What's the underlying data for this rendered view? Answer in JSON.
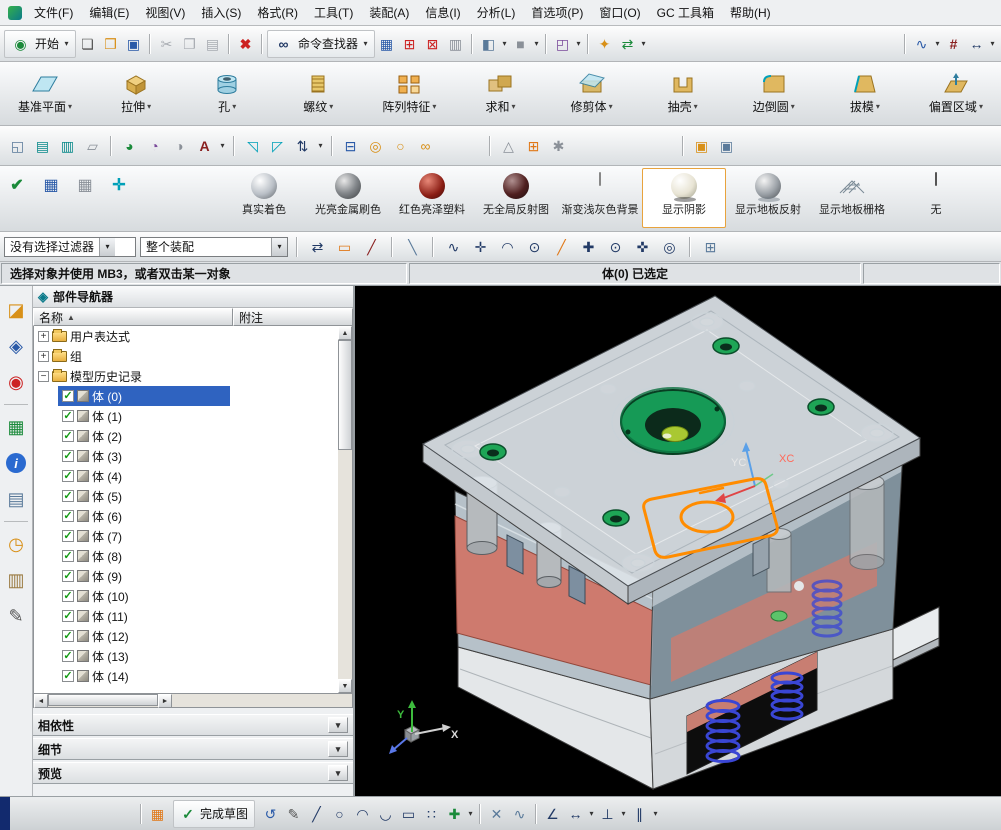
{
  "glyphs": {
    "dd": "▾",
    "plus": "+",
    "minus": "−",
    "check": "✓",
    "sort_asc": "▲",
    "left": "◄",
    "right": "►",
    "up": "▲",
    "down": "▼",
    "chev": "▾"
  },
  "menubar": {
    "items": [
      "文件(F)",
      "编辑(E)",
      "视图(V)",
      "插入(S)",
      "格式(R)",
      "工具(T)",
      "装配(A)",
      "信息(I)",
      "分析(L)",
      "首选项(P)",
      "窗口(O)",
      "GC 工具箱",
      "帮助(H)"
    ]
  },
  "toolbar_main": {
    "start_label": "开始",
    "command_finder_label": "命令查找器"
  },
  "features": {
    "items": [
      "基准平面",
      "拉伸",
      "孔",
      "螺纹",
      "阵列特征",
      "求和",
      "修剪体",
      "抽壳",
      "边倒圆",
      "拔模",
      "偏置区域"
    ]
  },
  "render_bar": {
    "items": [
      {
        "label": "真实着色",
        "selected": false
      },
      {
        "label": "光亮金属刷色",
        "selected": false
      },
      {
        "label": "红色亮泽塑料",
        "selected": false
      },
      {
        "label": "无全局反射图",
        "selected": false
      },
      {
        "label": "渐变浅灰色背景",
        "selected": false
      },
      {
        "label": "显示阴影",
        "selected": true
      },
      {
        "label": "显示地板反射",
        "selected": false
      },
      {
        "label": "显示地板栅格",
        "selected": false
      },
      {
        "label": "无",
        "selected": false
      }
    ]
  },
  "selection_bar": {
    "filter_value": "没有选择过滤器",
    "scope_value": "整个装配"
  },
  "status_bar": {
    "prompt": "选择对象并使用 MB3，或者双击某一对象",
    "status": "体(0) 已选定"
  },
  "navigator": {
    "title": "部件导航器",
    "columns": {
      "name": "名称",
      "note": "附注"
    },
    "folders": [
      {
        "label": "用户表达式",
        "state": "collapsed"
      },
      {
        "label": "组",
        "state": "collapsed"
      },
      {
        "label": "模型历史记录",
        "state": "expanded"
      }
    ],
    "bodies": [
      {
        "label": "体 (0)",
        "checked": true,
        "selected": true
      },
      {
        "label": "体 (1)",
        "checked": true
      },
      {
        "label": "体 (2)",
        "checked": true
      },
      {
        "label": "体 (3)",
        "checked": true
      },
      {
        "label": "体 (4)",
        "checked": true
      },
      {
        "label": "体 (5)",
        "checked": true
      },
      {
        "label": "体 (6)",
        "checked": true
      },
      {
        "label": "体 (7)",
        "checked": true
      },
      {
        "label": "体 (8)",
        "checked": true
      },
      {
        "label": "体 (9)",
        "checked": true
      },
      {
        "label": "体 (10)",
        "checked": true
      },
      {
        "label": "体 (11)",
        "checked": true
      },
      {
        "label": "体 (12)",
        "checked": true
      },
      {
        "label": "体 (13)",
        "checked": true
      },
      {
        "label": "体 (14)",
        "checked": true
      }
    ],
    "panels": [
      {
        "label": "相依性"
      },
      {
        "label": "细节"
      },
      {
        "label": "预览"
      }
    ]
  },
  "viewport": {
    "axis_labels": {
      "yc": "YC",
      "xc": "XC",
      "x": "X",
      "y": "Y"
    }
  },
  "bottom_bar": {
    "finish_label": "完成草图"
  },
  "icons": {
    "row2": [
      {
        "n": "start",
        "g": "◉"
      },
      {
        "n": "new-file",
        "g": "❏"
      },
      {
        "n": "open",
        "g": "❒"
      },
      {
        "n": "save",
        "g": "▣"
      },
      {
        "n": "cut",
        "g": "✂"
      },
      {
        "n": "copy",
        "g": "❐"
      },
      {
        "n": "paste",
        "g": "▤"
      },
      {
        "n": "delete",
        "g": "✖"
      },
      {
        "n": "command-finder",
        "g": "∞"
      },
      {
        "n": "window",
        "g": "▦"
      },
      {
        "n": "capture",
        "g": "⊞"
      },
      {
        "n": "capture-region",
        "g": "⊠"
      },
      {
        "n": "print",
        "g": "▥"
      },
      {
        "n": "view-cube",
        "g": "◧"
      },
      {
        "n": "display-mode",
        "g": "■"
      },
      {
        "n": "cascade",
        "g": "◰"
      },
      {
        "n": "spark",
        "g": "✦"
      },
      {
        "n": "export",
        "g": "⇄"
      },
      {
        "n": "curve",
        "g": "∿"
      },
      {
        "n": "pattern",
        "g": "#"
      },
      {
        "n": "measure",
        "g": "↔"
      }
    ],
    "row4": [
      {
        "n": "view-window",
        "g": "◱"
      },
      {
        "n": "layer-settings",
        "g": "▤"
      },
      {
        "n": "layer-category",
        "g": "▥"
      },
      {
        "n": "sheet",
        "g": "▱"
      },
      {
        "n": "shaded-view",
        "g": "◕"
      },
      {
        "n": "wireframe-view",
        "g": "◔"
      },
      {
        "n": "render-style",
        "g": "◑"
      },
      {
        "n": "annotation",
        "g": "A"
      },
      {
        "n": "datum-plane-sm",
        "g": "◹"
      },
      {
        "n": "datum-axis-sm",
        "g": "◸"
      },
      {
        "n": "sort",
        "g": "⇅"
      },
      {
        "n": "expressions-db",
        "g": "⊟"
      },
      {
        "n": "coins",
        "g": "◎"
      },
      {
        "n": "ring",
        "g": "○"
      },
      {
        "n": "link",
        "g": "∞"
      },
      {
        "n": "triangle-mesh",
        "g": "△"
      },
      {
        "n": "grid-plus",
        "g": "⊞"
      },
      {
        "n": "gears",
        "g": "✱"
      },
      {
        "n": "assembly-pair",
        "g": "▣"
      },
      {
        "n": "assembly-pair-2",
        "g": "▣"
      }
    ],
    "row5": [
      {
        "n": "sketch-check",
        "g": "✔"
      },
      {
        "n": "spreadsheet",
        "g": "▦"
      },
      {
        "n": "grid",
        "g": "▦"
      },
      {
        "n": "csys",
        "g": "✛"
      }
    ],
    "snap": [
      {
        "n": "two-point",
        "g": "⇄"
      },
      {
        "n": "rect-snap",
        "g": "▭"
      },
      {
        "n": "end-point",
        "g": "╱"
      },
      {
        "n": "mid-point",
        "g": "╲"
      },
      {
        "n": "curve-snap",
        "g": "∿"
      },
      {
        "n": "control-point",
        "g": "✛"
      },
      {
        "n": "arc-snap",
        "g": "◠"
      },
      {
        "n": "circle-center",
        "g": "⊙"
      },
      {
        "n": "point-on-curve",
        "g": "╱"
      },
      {
        "n": "plus-snap",
        "g": "✚"
      },
      {
        "n": "bounded-center",
        "g": "⊙"
      },
      {
        "n": "quadrant",
        "g": "✜"
      },
      {
        "n": "point-on-face",
        "g": "◎"
      },
      {
        "n": "grid-snap",
        "g": "⊞"
      }
    ],
    "strip": [
      {
        "n": "assembly-navigator",
        "g": "◪"
      },
      {
        "n": "constraint-navigator",
        "g": "◈"
      },
      {
        "n": "part-navigator",
        "g": "◉"
      },
      {
        "n": "reuse-library",
        "g": "▦"
      },
      {
        "n": "web-browser",
        "g": "i"
      },
      {
        "n": "history",
        "g": "▤"
      },
      {
        "n": "clock",
        "g": "◷"
      },
      {
        "n": "notes",
        "g": "▥"
      },
      {
        "n": "roles-pen",
        "g": "✎"
      }
    ],
    "bottom": [
      {
        "n": "sketch-grid",
        "g": "▦"
      },
      {
        "n": "undo",
        "g": "↺"
      },
      {
        "n": "profile-pen",
        "g": "✎"
      },
      {
        "n": "line",
        "g": "╱"
      },
      {
        "n": "circle",
        "g": "○"
      },
      {
        "n": "arc",
        "g": "◠"
      },
      {
        "n": "arc2",
        "g": "◡"
      },
      {
        "n": "rectangle",
        "g": "▭"
      },
      {
        "n": "point",
        "g": "∷"
      },
      {
        "n": "plus-tool",
        "g": "✚"
      },
      {
        "n": "trim",
        "g": "✕"
      },
      {
        "n": "spline",
        "g": "∿"
      },
      {
        "n": "angle",
        "g": "∠"
      },
      {
        "n": "dim-linear",
        "g": "↔"
      },
      {
        "n": "dim-perp",
        "g": "⊥"
      },
      {
        "n": "dim-parallel",
        "g": "∥"
      }
    ]
  },
  "colors": {
    "selection_blue": "#2f63c0",
    "selected_button_border": "#e8a33d",
    "viewport_bg": "#000000",
    "mold_salmon": "#ce7a6e",
    "ring_green": "#169a56",
    "spring_blue": "#3a46d4",
    "sketch_orange": "#ff8c00"
  }
}
